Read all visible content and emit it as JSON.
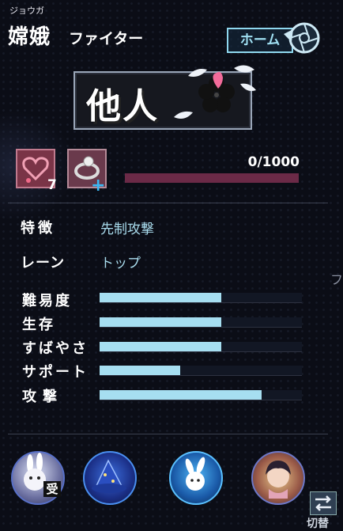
{
  "header": {
    "furigana": "ジョウガ",
    "name": "嫦娥",
    "role": "ファイター",
    "home_label": "ホーム"
  },
  "title_banner": {
    "text": "他人"
  },
  "items": {
    "count": "7",
    "plus": "+"
  },
  "progress": {
    "text": "0/1000",
    "current": 0,
    "max": 1000
  },
  "info": {
    "trait_label": "特徴",
    "trait_value": "先制攻撃",
    "lane_label": "レーン",
    "lane_value": "トップ"
  },
  "stats": [
    {
      "label": "難易度",
      "fraction": 0.6
    },
    {
      "label": "生存",
      "fraction": 0.6
    },
    {
      "label": "すばやさ",
      "fraction": 0.6
    },
    {
      "label": "サポート",
      "fraction": 0.4
    },
    {
      "label": "攻撃",
      "fraction": 0.8
    }
  ],
  "side_text": "フ",
  "skills": {
    "badge": "受"
  },
  "switch": {
    "label": "切替"
  },
  "colors": {
    "stat_fill": "#a6def0",
    "progress_track": "#6b2a47",
    "accent_blue": "#3bb9f5",
    "home_border": "#8fd7ee"
  }
}
